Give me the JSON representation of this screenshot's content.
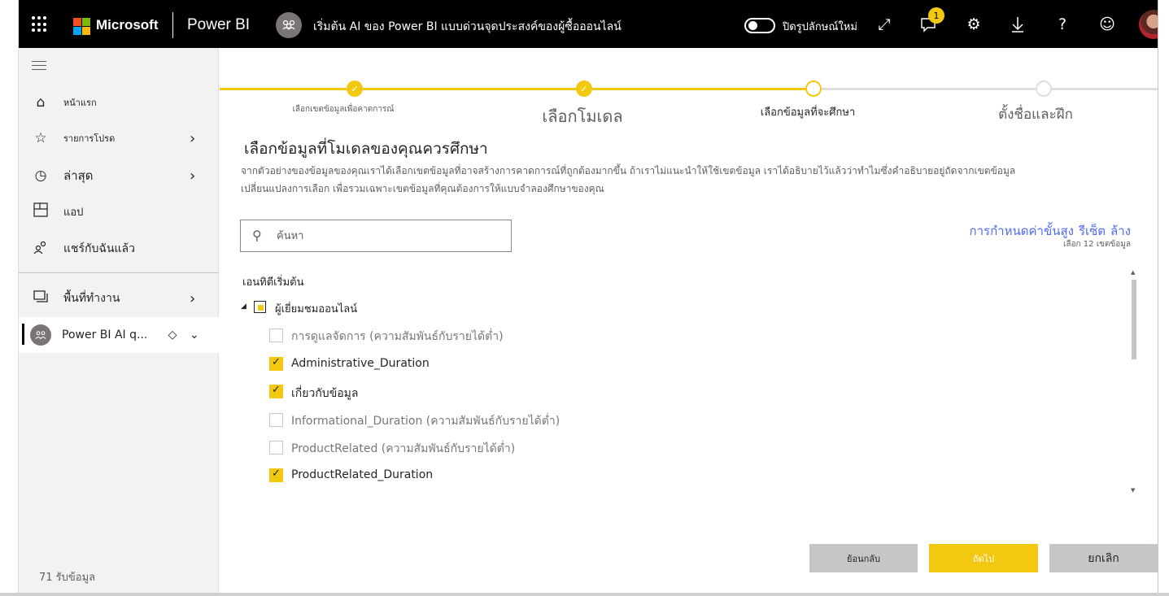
{
  "header": {
    "brand": "Microsoft",
    "product": "Power BI",
    "breadcrumb": "เริ่มต้น AI ของ Power BI แบบด่วนจุดประสงค์ของผู้ซื้อออนไลน์",
    "toggle_label": "ปิดรูปลักษณ์ใหม่",
    "notification_count": "1",
    "icons": [
      "waffle-icon",
      "expand-icon",
      "chat-icon",
      "gear-icon",
      "download-icon",
      "help-icon",
      "smiley-icon"
    ]
  },
  "sidebar": {
    "items": [
      {
        "label": "หน้าแรก",
        "icon": "home-icon"
      },
      {
        "label": "รายการโปรด",
        "icon": "star-icon"
      },
      {
        "label": "ล่าสุด",
        "icon": "clock-icon"
      },
      {
        "label": "แอป",
        "icon": "apps-icon"
      },
      {
        "label": "แชร์กับฉันแล้ว",
        "icon": "shared-icon"
      },
      {
        "label": "พื้นที่ทำงาน",
        "icon": "workspaces-icon"
      },
      {
        "label": "Power BI AI q...",
        "icon": "workspace-icon"
      }
    ],
    "footer": "71 รับข้อมูล"
  },
  "wizard": {
    "steps": [
      {
        "label": "เลือกเขตข้อมูลเพื่อคาดการณ์",
        "state": "done"
      },
      {
        "label": "เลือกโมเดล",
        "state": "done"
      },
      {
        "label": "เลือกข้อมูลที่จะศึกษา",
        "state": "current"
      },
      {
        "label": "ตั้งชื่อและฝึก",
        "state": "todo"
      }
    ],
    "title": "เลือกข้อมูลที่โมเดลของคุณควรศึกษา",
    "description_line1": "จากตัวอย่างของข้อมูลของคุณเราได้เลือกเขตข้อมูลที่อาจสร้างการคาดการณ์ที่ถูกต้องมากขึ้น ถ้าเราไม่แนะนำให้ใช้เขตข้อมูล เราได้อธิบายไว้แล้วว่าทำไมซึ่งคำอธิบายอยู่ถัดจากเขตข้อมูล",
    "description_line2": "เปลี่ยนแปลงการเลือก เพื่อรวมเฉพาะเขตข้อมูลที่คุณต้องการให้แบบจำลองศึกษาของคุณ",
    "search_placeholder": "ค้นหา",
    "links": {
      "advanced": "การกำหนดค่าขั้นสูง",
      "reset": "รีเซ็ต",
      "clear": "ล้าง"
    },
    "selected_count": "เลือก 12 เขตข้อมูล",
    "entity_header": "เอนทิตีเริ่มต้น",
    "entity_name": "ผู้เยี่ยมชมออนไลน์",
    "fields": [
      {
        "label": "การดูแลจัดการ (ความสัมพันธ์กับรายได้ต่ำ)",
        "checked": false
      },
      {
        "label": "Administrative_Duration",
        "checked": true
      },
      {
        "label": "เกี่ยวกับข้อมูล",
        "checked": true
      },
      {
        "label": "Informational_Duration (ความสัมพันธ์กับรายได้ต่ำ)",
        "checked": false
      },
      {
        "label": "ProductRelated (ความสัมพันธ์กับรายได้ต่ำ)",
        "checked": false
      },
      {
        "label": "ProductRelated_Duration",
        "checked": true
      }
    ],
    "buttons": {
      "back": "ย้อนกลับ",
      "next": "ถัดไป",
      "cancel": "ยกเลิก"
    }
  },
  "colors": {
    "accent": "#f2c811",
    "link": "#4f6bed",
    "topbar": "#000000"
  }
}
